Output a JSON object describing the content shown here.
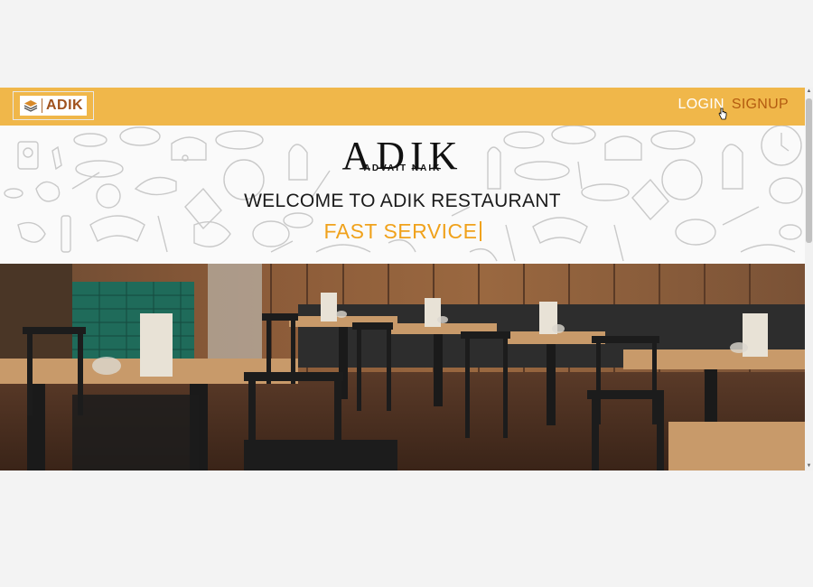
{
  "navbar": {
    "brand_text": "ADIK",
    "login_label": "LOGIN",
    "signup_label": "SIGNUP"
  },
  "hero": {
    "logo_title": "ADIK",
    "logo_subtitle": "ADVAIT NAIK",
    "welcome_text": "WELCOME TO ADIK RESTAURANT",
    "tagline_text": "FAST SERVICE"
  },
  "icons": {
    "brand_logo": "stacked-layers-logo-icon",
    "cursor": "hand-pointer-icon",
    "scroll_up": "chevron-up-icon",
    "scroll_down": "chevron-down-icon"
  },
  "colors": {
    "navbar_bg": "#f0b74a",
    "brand_text": "#a0521d",
    "login_text": "#ffffff",
    "signup_text": "#b35b10",
    "tagline": "#f0a21c"
  }
}
